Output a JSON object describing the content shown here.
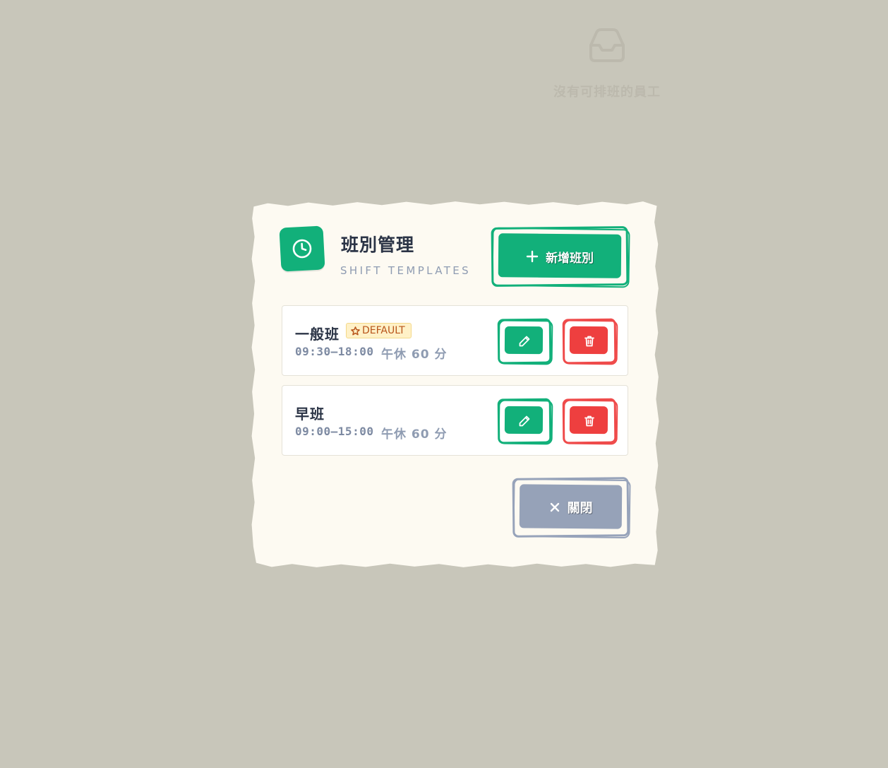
{
  "background": {
    "empty_state_icon": "inbox-icon",
    "empty_state_text": "沒有可排班的員工"
  },
  "modal": {
    "icon": "clock-icon",
    "title": "班別管理",
    "subtitle": "SHIFT TEMPLATES",
    "add_button": {
      "icon": "plus-icon",
      "label": "新增班別"
    },
    "close_button": {
      "icon": "close-icon",
      "label": "關閉"
    },
    "shifts": [
      {
        "name": "一般班",
        "badge": {
          "icon": "star-icon",
          "label": "DEFAULT"
        },
        "time": "09:30–18:00",
        "lunch": "午休 60 分",
        "edit_icon": "pencil-icon",
        "delete_icon": "trash-icon"
      },
      {
        "name": "早班",
        "time": "09:00–15:00",
        "lunch": "午休 60 分",
        "edit_icon": "pencil-icon",
        "delete_icon": "trash-icon"
      }
    ]
  },
  "colors": {
    "primary": "#12b07a",
    "danger": "#ee3f3f",
    "neutral": "#96a2b8",
    "badge_bg": "#fff1c7",
    "badge_text": "#b8551b",
    "backdrop": "#c8c6ba",
    "paper": "#fdfaf2"
  }
}
